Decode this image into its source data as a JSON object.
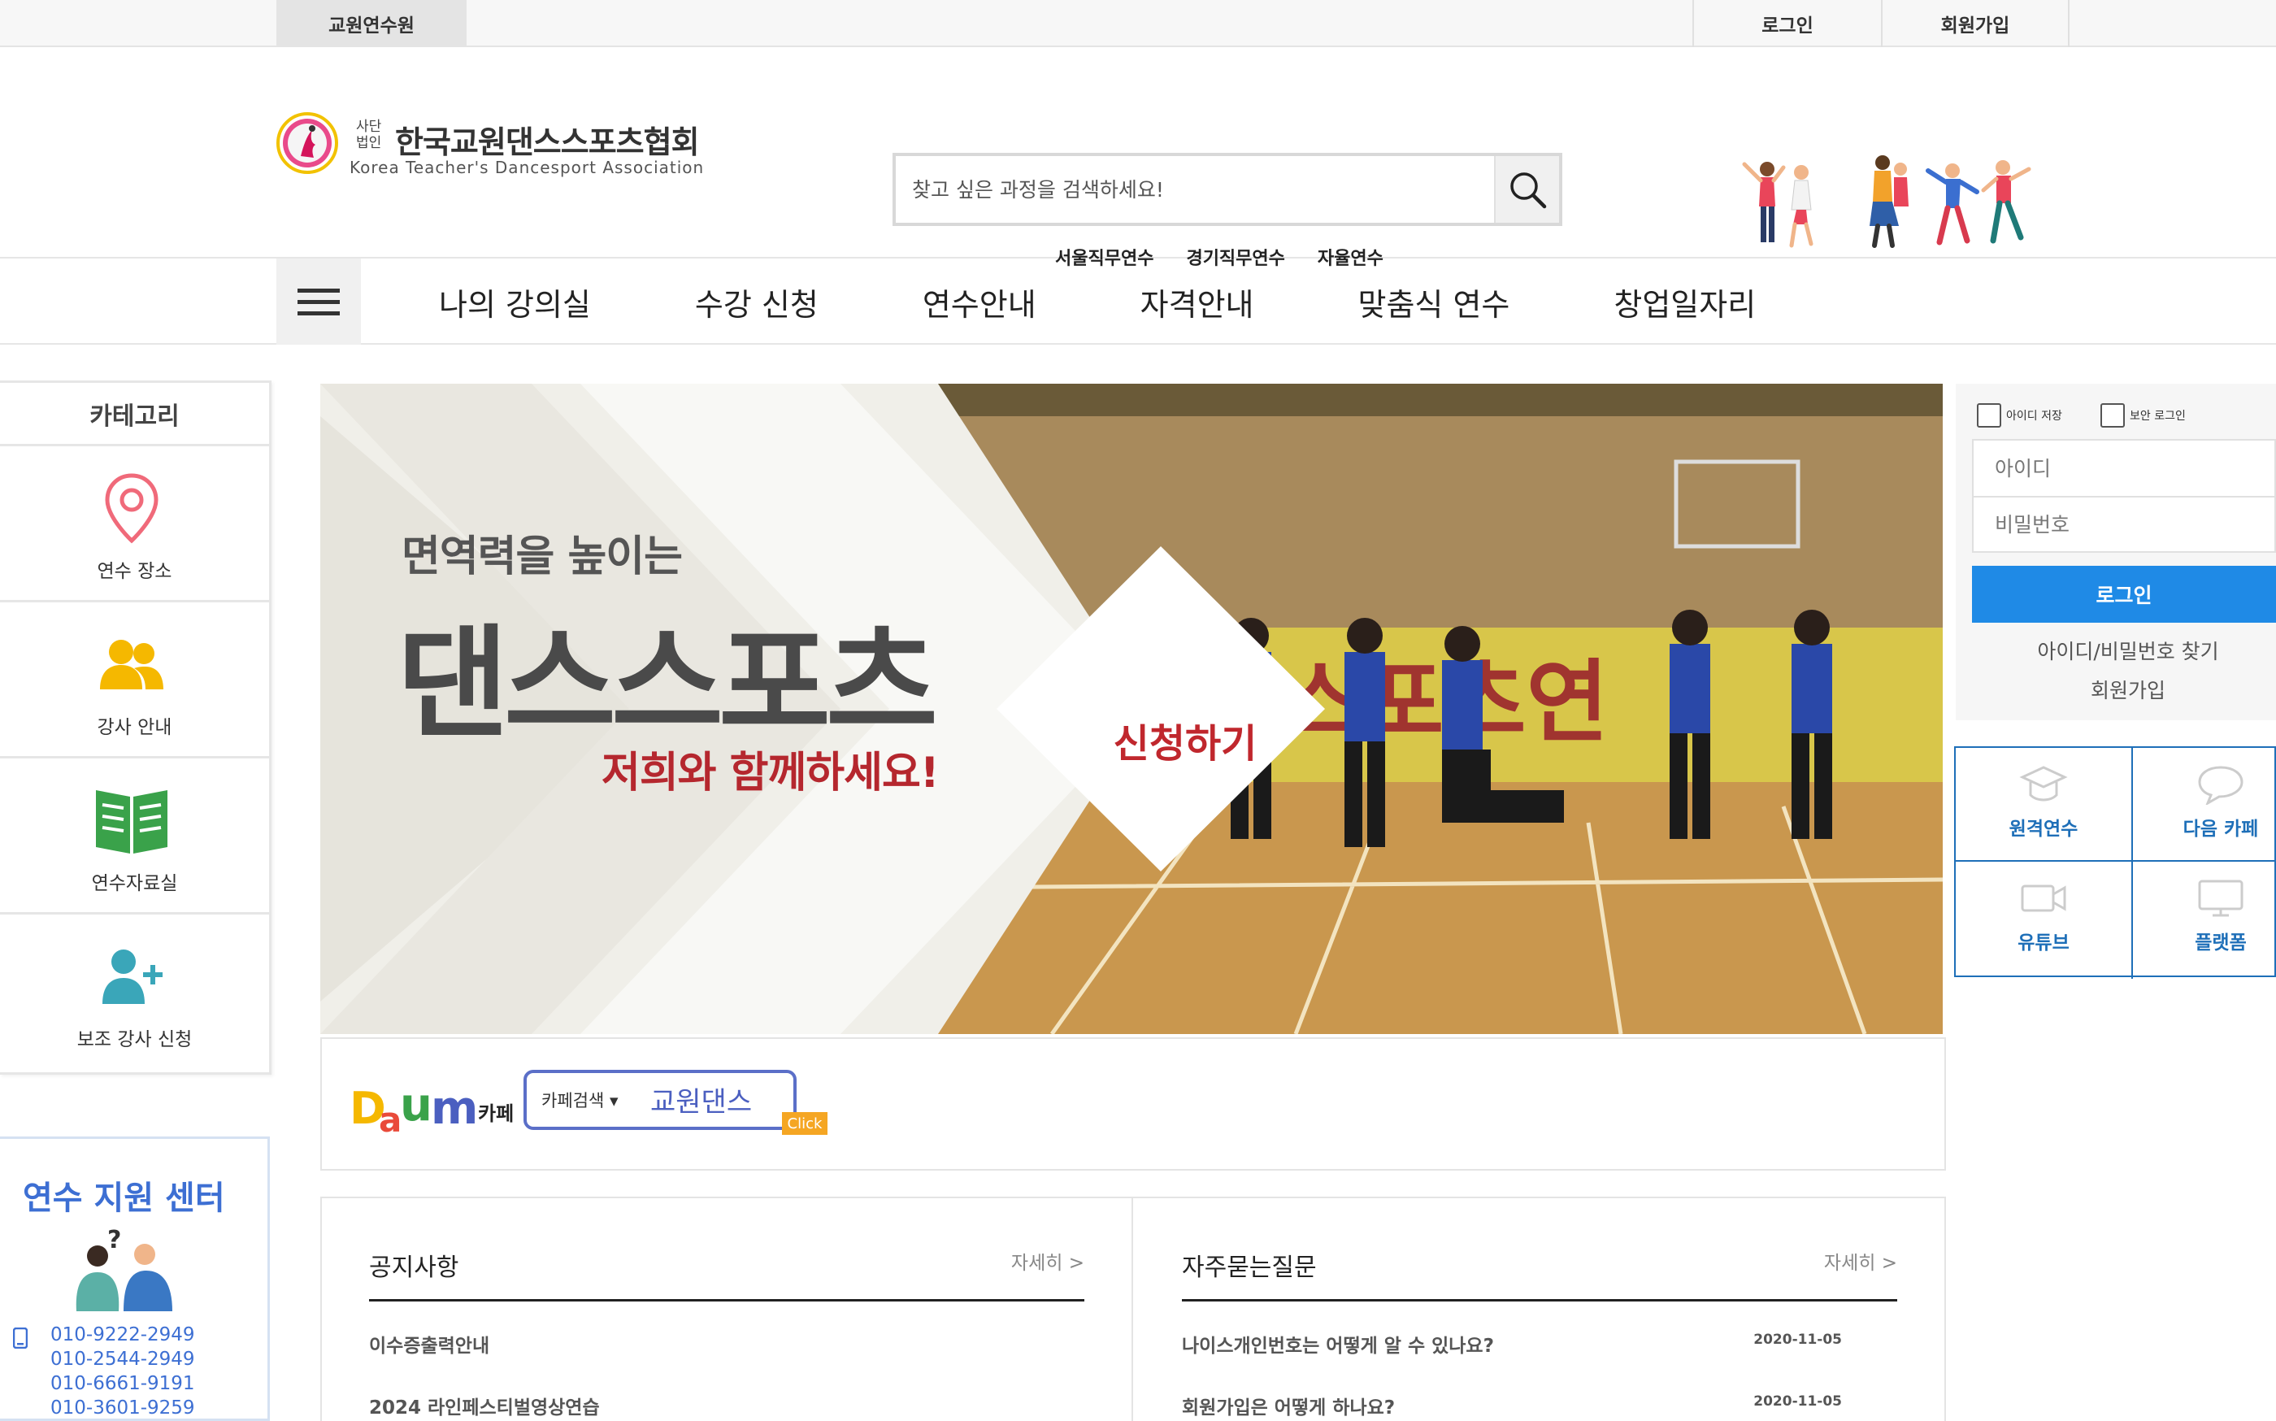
{
  "topbar": {
    "site_tab": "교원연수원",
    "login": "로그인",
    "join": "회원가입"
  },
  "header": {
    "logo": {
      "corp_label": "사단법인",
      "name_kr": "한국교원댄스스포츠협회",
      "name_en": "Korea Teacher's Dancesport Association"
    },
    "search": {
      "placeholder": "찾고 싶은 과정을 검색하세요!",
      "icon": "search-icon"
    },
    "quick_links": [
      "서울직무연수",
      "경기직무연수",
      "자율연수"
    ]
  },
  "nav": {
    "menu_icon": "hamburger-icon",
    "items": [
      "나의 강의실",
      "수강 신청",
      "연수안내",
      "자격안내",
      "맞춤식 연수",
      "창업일자리"
    ]
  },
  "category": {
    "title": "카테고리",
    "items": [
      {
        "label": "연수 장소",
        "icon": "location-pin-icon",
        "color": "#f06a7a"
      },
      {
        "label": "강사 안내",
        "icon": "people-icon",
        "color": "#f5b800"
      },
      {
        "label": "연수자료실",
        "icon": "open-book-icon",
        "color": "#3aa24a"
      },
      {
        "label": "보조 강사 신청",
        "icon": "add-user-icon",
        "color": "#3aa6b9"
      }
    ]
  },
  "support": {
    "title": "연수 지원 센터",
    "phones": [
      "010-9222-2949",
      "010-2544-2949",
      "010-6661-9191",
      "010-3601-9259"
    ]
  },
  "banner": {
    "subtitle": "면역력을 높이는",
    "title": "댄스스포츠",
    "tagline": "저희와 함께하세요!",
    "apply": "신청하기"
  },
  "cafe": {
    "label": "카페",
    "select": "카페검색 ▾",
    "term": "교원댄스",
    "click": "Click"
  },
  "boards": {
    "notice": {
      "title": "공지사항",
      "more": "자세히 >",
      "rows": [
        {
          "title": "이수증출력안내",
          "date": ""
        },
        {
          "title": "2024 라인페스티벌영상연습",
          "date": ""
        }
      ]
    },
    "faq": {
      "title": "자주묻는질문",
      "more": "자세히 >",
      "rows": [
        {
          "title": "나이스개인번호는 어떻게 알 수 있나요?",
          "date": "2020-11-05"
        },
        {
          "title": "회원가입은 어떻게 하나요?",
          "date": "2020-11-05"
        }
      ]
    }
  },
  "login": {
    "save_id": "아이디 저장",
    "secure_login": "보안 로그인",
    "id_placeholder": "아이디",
    "pw_placeholder": "비밀번호",
    "button": "로그인",
    "find": "아이디/비밀번호 찾기",
    "join": "회원가입"
  },
  "quick_menu": [
    {
      "label": "원격연수",
      "icon": "graduation-cap-icon"
    },
    {
      "label": "다음 카페",
      "icon": "speech-bubble-icon"
    },
    {
      "label": "유튜브",
      "icon": "video-camera-icon"
    },
    {
      "label": "플랫폼",
      "icon": "monitor-icon"
    }
  ],
  "colors": {
    "accent_blue": "#1f8ae6",
    "quick_blue": "#1e6fb8",
    "support_blue": "#3d6fd3",
    "banner_red": "#c0272d"
  }
}
